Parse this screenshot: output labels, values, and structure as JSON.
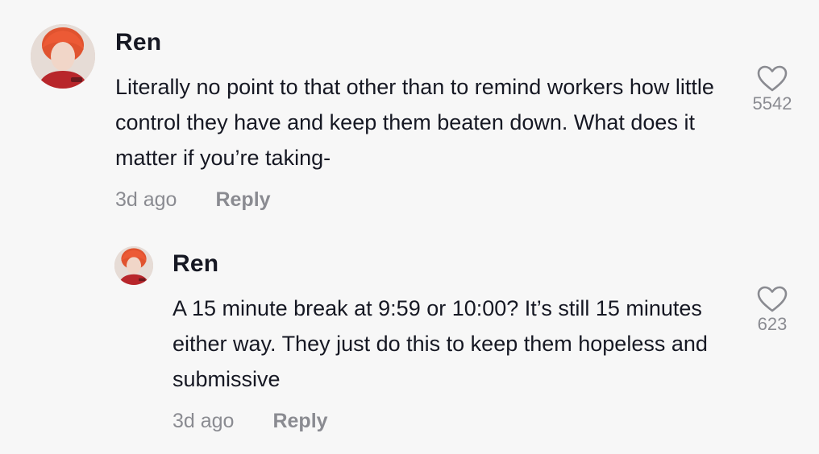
{
  "comments": [
    {
      "username": "Ren",
      "text": "Literally no point to that other than to remind workers how little control they have and keep them beaten down. What does it matter if you’re taking-",
      "time": "3d ago",
      "reply_label": "Reply",
      "likes": "5542"
    },
    {
      "username": "Ren",
      "text": "A 15 minute break at 9:59 or 10:00? It’s still 15 minutes either way. They just do this to keep them hopeless and submissive",
      "time": "3d ago",
      "reply_label": "Reply",
      "likes": "623"
    }
  ],
  "icons": {
    "like": "heart-outline-icon"
  },
  "colors": {
    "background": "#f7f7f7",
    "text": "#161823",
    "muted": "#8a8b91"
  }
}
